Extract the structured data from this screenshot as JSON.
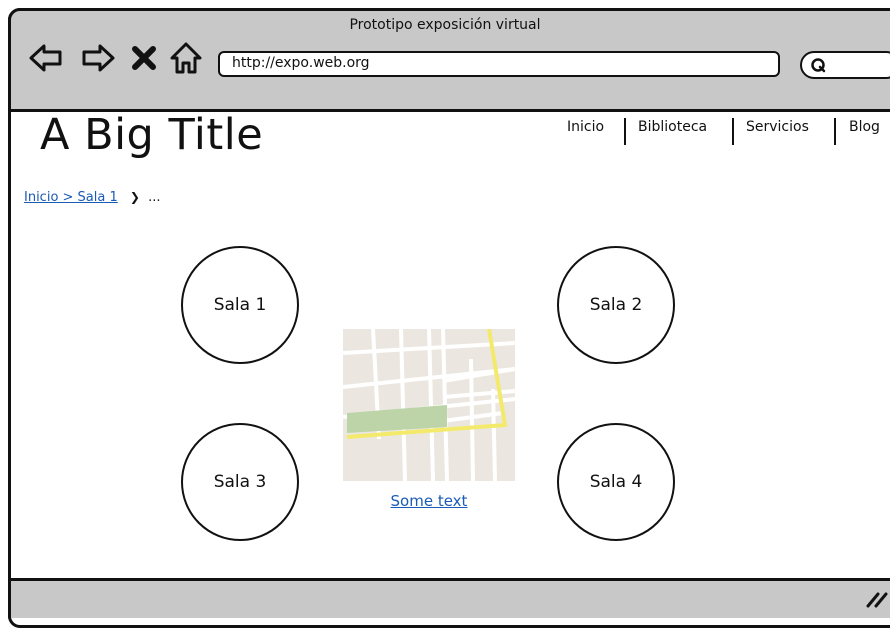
{
  "window": {
    "title": "Prototipo exposición virtual"
  },
  "toolbar": {
    "back_icon": "back-arrow-icon",
    "forward_icon": "forward-arrow-icon",
    "close_icon": "close-icon",
    "home_icon": "home-icon",
    "url": "http://expo.web.org",
    "search_icon": "search-icon"
  },
  "page": {
    "title": "A Big Title",
    "nav": [
      "Inicio",
      "Biblioteca",
      "Servicios",
      "Blog"
    ],
    "breadcrumb": {
      "link": "Inicio > Sala 1",
      "chevron": "❯",
      "rest": "..."
    }
  },
  "rooms": [
    "Sala 1",
    "Sala 2",
    "Sala 3",
    "Sala 4"
  ],
  "map": {
    "caption": "Some text"
  },
  "colors": {
    "chrome": "#c8c8c8",
    "link": "#1a5bb5",
    "park": "#bcd4a8",
    "road": "#f3ea6c",
    "map_bg": "#ebe7e0"
  }
}
